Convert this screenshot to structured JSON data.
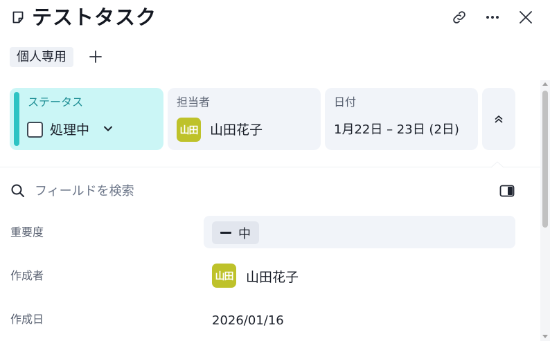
{
  "header": {
    "icon": "note-icon",
    "title": "テストタスク",
    "actions": [
      "link-icon",
      "more-icon",
      "close-icon"
    ]
  },
  "tags": {
    "items": [
      "個人専用"
    ],
    "add_icon": "plus-icon"
  },
  "properties": {
    "status": {
      "label": "ステータス",
      "value": "処理中",
      "color": "#2dc3c3",
      "background": "#cbf6f6"
    },
    "assignee": {
      "label": "担当者",
      "avatar_text": "山田",
      "name": "山田花子",
      "avatar_color": "#bec22a"
    },
    "date": {
      "label": "日付",
      "value": "1月22日 – 23日 (2日)"
    },
    "collapse_icon": "chevrons-up-icon"
  },
  "search": {
    "placeholder": "フィールドを検索",
    "value": ""
  },
  "fields": [
    {
      "label": "重要度",
      "value": "中"
    },
    {
      "label": "作成者",
      "avatar_text": "山田",
      "value": "山田花子"
    },
    {
      "label": "作成日",
      "value": "2026/01/16"
    }
  ]
}
